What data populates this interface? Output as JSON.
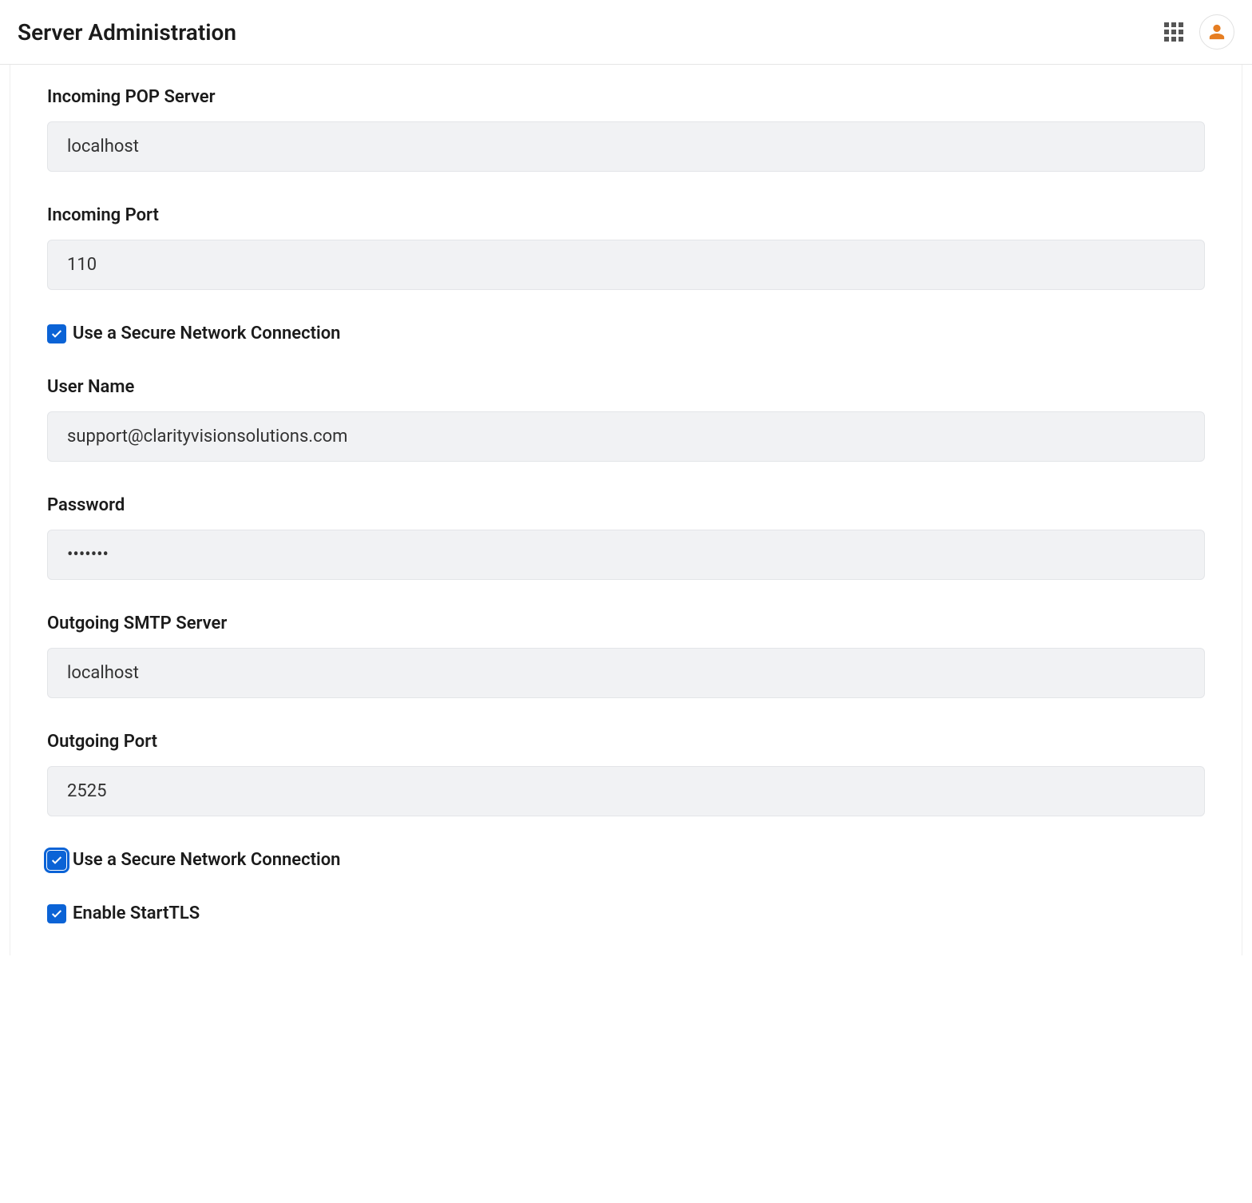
{
  "header": {
    "title": "Server Administration"
  },
  "form": {
    "incoming_pop": {
      "label": "Incoming POP Server",
      "value": "localhost"
    },
    "incoming_port": {
      "label": "Incoming Port",
      "value": "110"
    },
    "secure_in": {
      "label": "Use a Secure Network Connection",
      "checked": true
    },
    "username": {
      "label": "User Name",
      "value": "support@clarityvisionsolutions.com"
    },
    "password": {
      "label": "Password",
      "value": "•••••••"
    },
    "outgoing_smtp": {
      "label": "Outgoing SMTP Server",
      "value": "localhost"
    },
    "outgoing_port": {
      "label": "Outgoing Port",
      "value": "2525"
    },
    "secure_out": {
      "label": "Use a Secure Network Connection",
      "checked": true
    },
    "starttls": {
      "label": "Enable StartTLS",
      "checked": true
    }
  }
}
